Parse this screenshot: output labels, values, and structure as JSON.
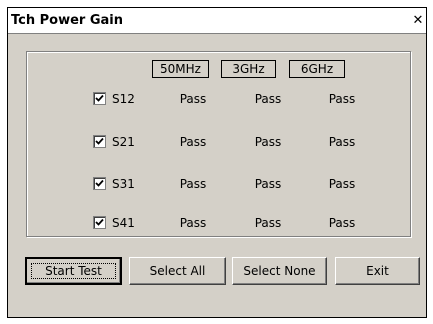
{
  "window": {
    "title": "Tch Power Gain",
    "close_glyph": "✕"
  },
  "frequencies": [
    "50MHz",
    "3GHz",
    "6GHz"
  ],
  "rows": [
    {
      "label": "S12",
      "checked": true,
      "results": [
        "Pass",
        "Pass",
        "Pass"
      ]
    },
    {
      "label": "S21",
      "checked": true,
      "results": [
        "Pass",
        "Pass",
        "Pass"
      ]
    },
    {
      "label": "S31",
      "checked": true,
      "results": [
        "Pass",
        "Pass",
        "Pass"
      ]
    },
    {
      "label": "S41",
      "checked": true,
      "results": [
        "Pass",
        "Pass",
        "Pass"
      ]
    }
  ],
  "buttons": {
    "start_test": "Start Test",
    "select_all": "Select All",
    "select_none": "Select None",
    "exit": "Exit"
  }
}
